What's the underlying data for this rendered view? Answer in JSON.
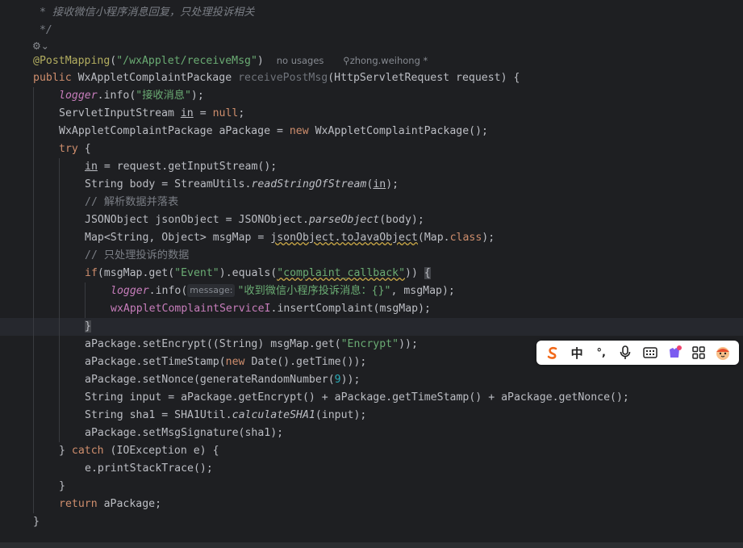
{
  "code": {
    "doc_comment": " * 接收微信小程序消息回复，只处理投诉相关",
    "doc_end": " */",
    "annotation": "@PostMapping",
    "mapping_path": "\"/wxApplet/receiveMsg\"",
    "usages_hint": "no usages",
    "author_hint": "zhong.weihong *",
    "comment_parse": "// 解析数据并落表",
    "comment_filter": "// 只处理投诉的数据",
    "str_receive": "\"接收消息\"",
    "str_event": "\"Event\"",
    "str_complaint": "\"complaint_callback\"",
    "param_hint_message": "message:",
    "str_log": "\"收到微信小程序投诉消息：{}\"",
    "str_encrypt": "\"Encrypt\"",
    "nonce_len": "9"
  },
  "ime_toolbar": {
    "mode_label": "中",
    "punct_label": "°,"
  },
  "colors": {
    "background": "#1e1f22",
    "keyword": "#cf8e6d",
    "string": "#6aab73",
    "method": "#56a8f5",
    "field": "#c77dbb",
    "annotation": "#b3ae60",
    "comment": "#7a7e85"
  }
}
